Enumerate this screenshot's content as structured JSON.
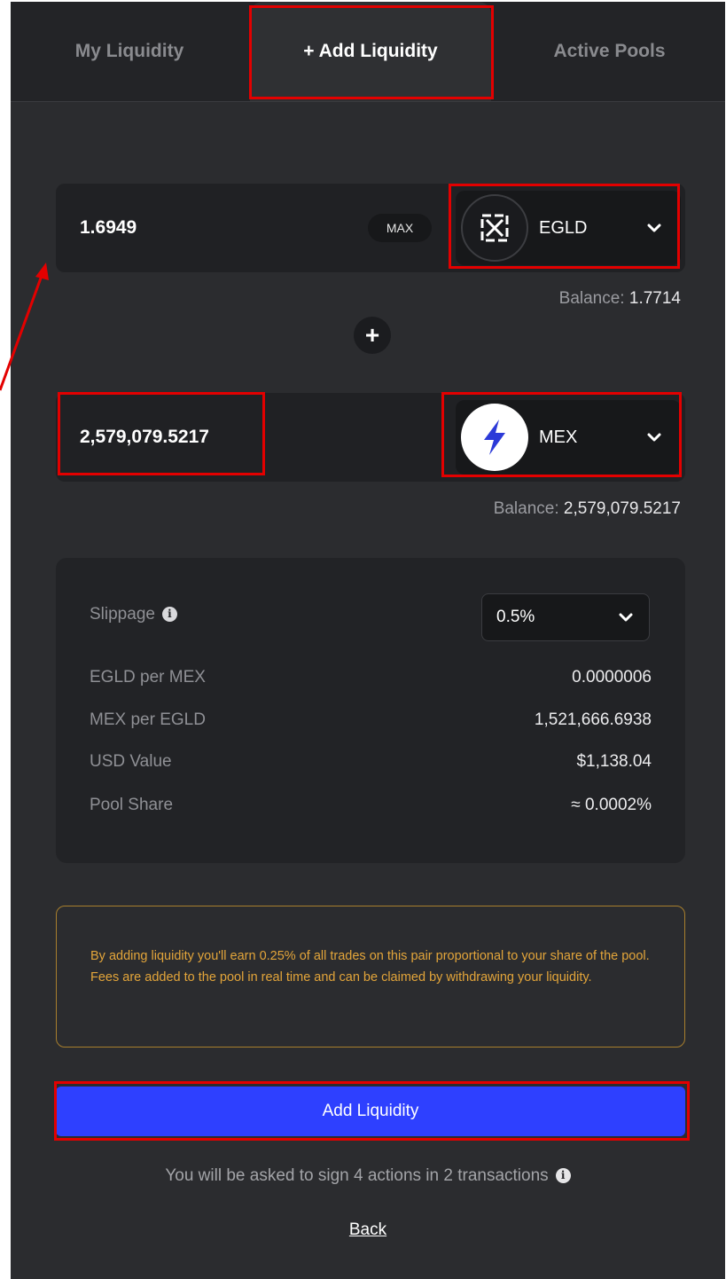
{
  "tabs": [
    {
      "label": "My Liquidity",
      "active": false
    },
    {
      "label": "+ Add Liquidity",
      "active": true
    },
    {
      "label": "Active Pools",
      "active": false
    }
  ],
  "first_token": {
    "amount": "1.6949",
    "max_label": "MAX",
    "symbol": "EGLD",
    "icon": "egld-logo-icon",
    "balance_label": "Balance:",
    "balance_value": "1.7714"
  },
  "plus_symbol": "+",
  "second_token": {
    "amount": "2,579,079.5217",
    "symbol": "MEX",
    "icon": "lightning-bolt-icon",
    "balance_label": "Balance:",
    "balance_value": "2,579,079.5217"
  },
  "details": {
    "slippage_label": "Slippage",
    "slippage_value": "0.5%",
    "rows": [
      {
        "label": "EGLD per MEX",
        "value": "0.0000006"
      },
      {
        "label": "MEX per EGLD",
        "value": "1,521,666.6938"
      },
      {
        "label": "USD Value",
        "value": "$1,138.04"
      },
      {
        "label": "Pool Share",
        "value": "≈ 0.0002%"
      }
    ]
  },
  "notice": "By adding liquidity you'll earn 0.25% of all trades on this pair proportional to your share of the pool. Fees are added to the pool in real time and can be claimed by withdrawing your liquidity.",
  "add_button_label": "Add Liquidity",
  "sign_note": "You will be asked to sign 4 actions in 2 transactions",
  "back_label": "Back",
  "colors": {
    "panel_bg": "#2b2c2f",
    "primary_button": "#2e40ff",
    "notice_text": "#e3a53a",
    "highlight": "#e30000"
  }
}
